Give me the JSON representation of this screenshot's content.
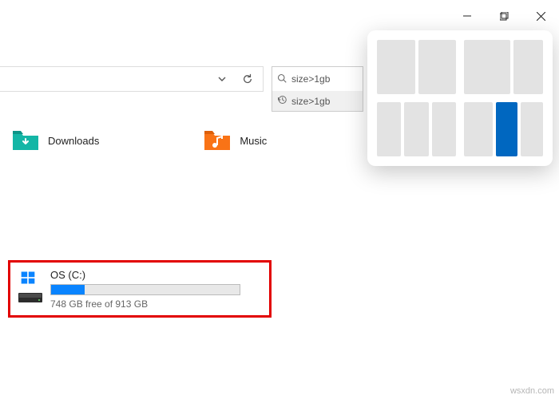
{
  "titlebar": {
    "minimize": "min",
    "maximize": "max",
    "close": "close"
  },
  "search": {
    "query": "size>1gb",
    "suggestion": "size>1gb"
  },
  "folders": [
    {
      "name": "Downloads",
      "color": "#14b6a6"
    },
    {
      "name": "Music",
      "color": "#f97316"
    }
  ],
  "drive": {
    "name": "OS (C:)",
    "free_text": "748 GB free of 913 GB",
    "used_pct": 18
  },
  "watermark": "wsxdn.com"
}
